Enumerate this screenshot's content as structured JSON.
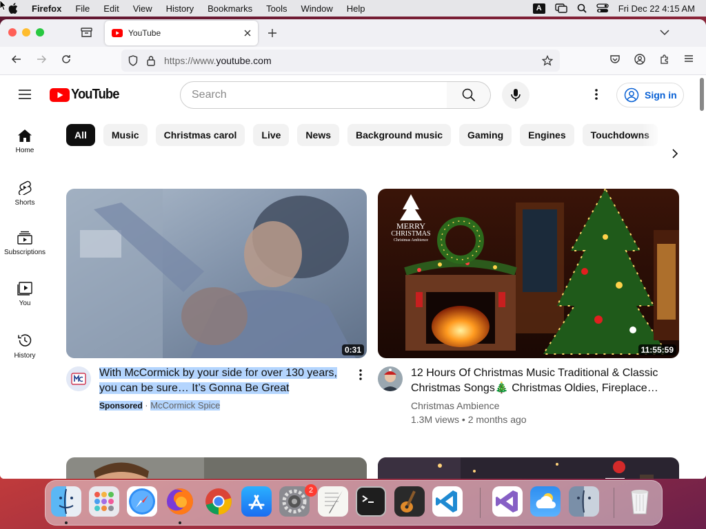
{
  "menubar": {
    "app": "Firefox",
    "items": [
      "File",
      "Edit",
      "View",
      "History",
      "Bookmarks",
      "Tools",
      "Window",
      "Help"
    ],
    "input_indicator": "A",
    "clock": "Fri Dec 22  4:15 AM"
  },
  "browser": {
    "tab_title": "YouTube",
    "url_prefix": "https://www.",
    "url_domain": "youtube.com"
  },
  "youtube": {
    "logo_text": "YouTube",
    "search_placeholder": "Search",
    "sign_in": "Sign in",
    "chips": [
      "All",
      "Music",
      "Christmas carol",
      "Live",
      "News",
      "Background music",
      "Gaming",
      "Engines",
      "Touchdowns"
    ],
    "sidebar": [
      {
        "label": "Home",
        "icon": "home-icon"
      },
      {
        "label": "Shorts",
        "icon": "shorts-icon"
      },
      {
        "label": "Subscriptions",
        "icon": "subscriptions-icon"
      },
      {
        "label": "You",
        "icon": "you-icon"
      },
      {
        "label": "History",
        "icon": "history-icon"
      }
    ],
    "videos": [
      {
        "title_line1": "With McCormick by your side for over 130 years,",
        "title_line2": "you can be sure… It’s Gonna Be Great",
        "badge": "Sponsored",
        "separator": "·",
        "channel": "McCormick Spice",
        "duration": "0:31"
      },
      {
        "title_line1": "12 Hours Of Christmas Music Traditional & Classic",
        "title_line2": "Christmas Songs🎄 Christmas Oldies, Fireplace…",
        "channel": "Christmas Ambience",
        "views": "1.3M views",
        "age": "2 months ago",
        "duration": "11:55:59",
        "thumb_text_1": "MERRY",
        "thumb_text_2": "CHRISTMAS",
        "thumb_text_3": "Christmas Ambience"
      }
    ]
  },
  "dock": {
    "notification_badge": "2",
    "apps": [
      "finder-icon",
      "launchpad-icon",
      "safari-icon",
      "firefox-icon",
      "chrome-icon",
      "app-store-icon",
      "system-settings-icon",
      "textedit-icon",
      "terminal-icon",
      "garageband-icon",
      "vscode-icon",
      "visual-studio-icon",
      "weather-icon",
      "finder-folder-icon",
      "trash-icon"
    ]
  },
  "colors": {
    "youtube_red": "#ff0000",
    "link_blue": "#065fd4",
    "selection": "#b4d5fe"
  }
}
